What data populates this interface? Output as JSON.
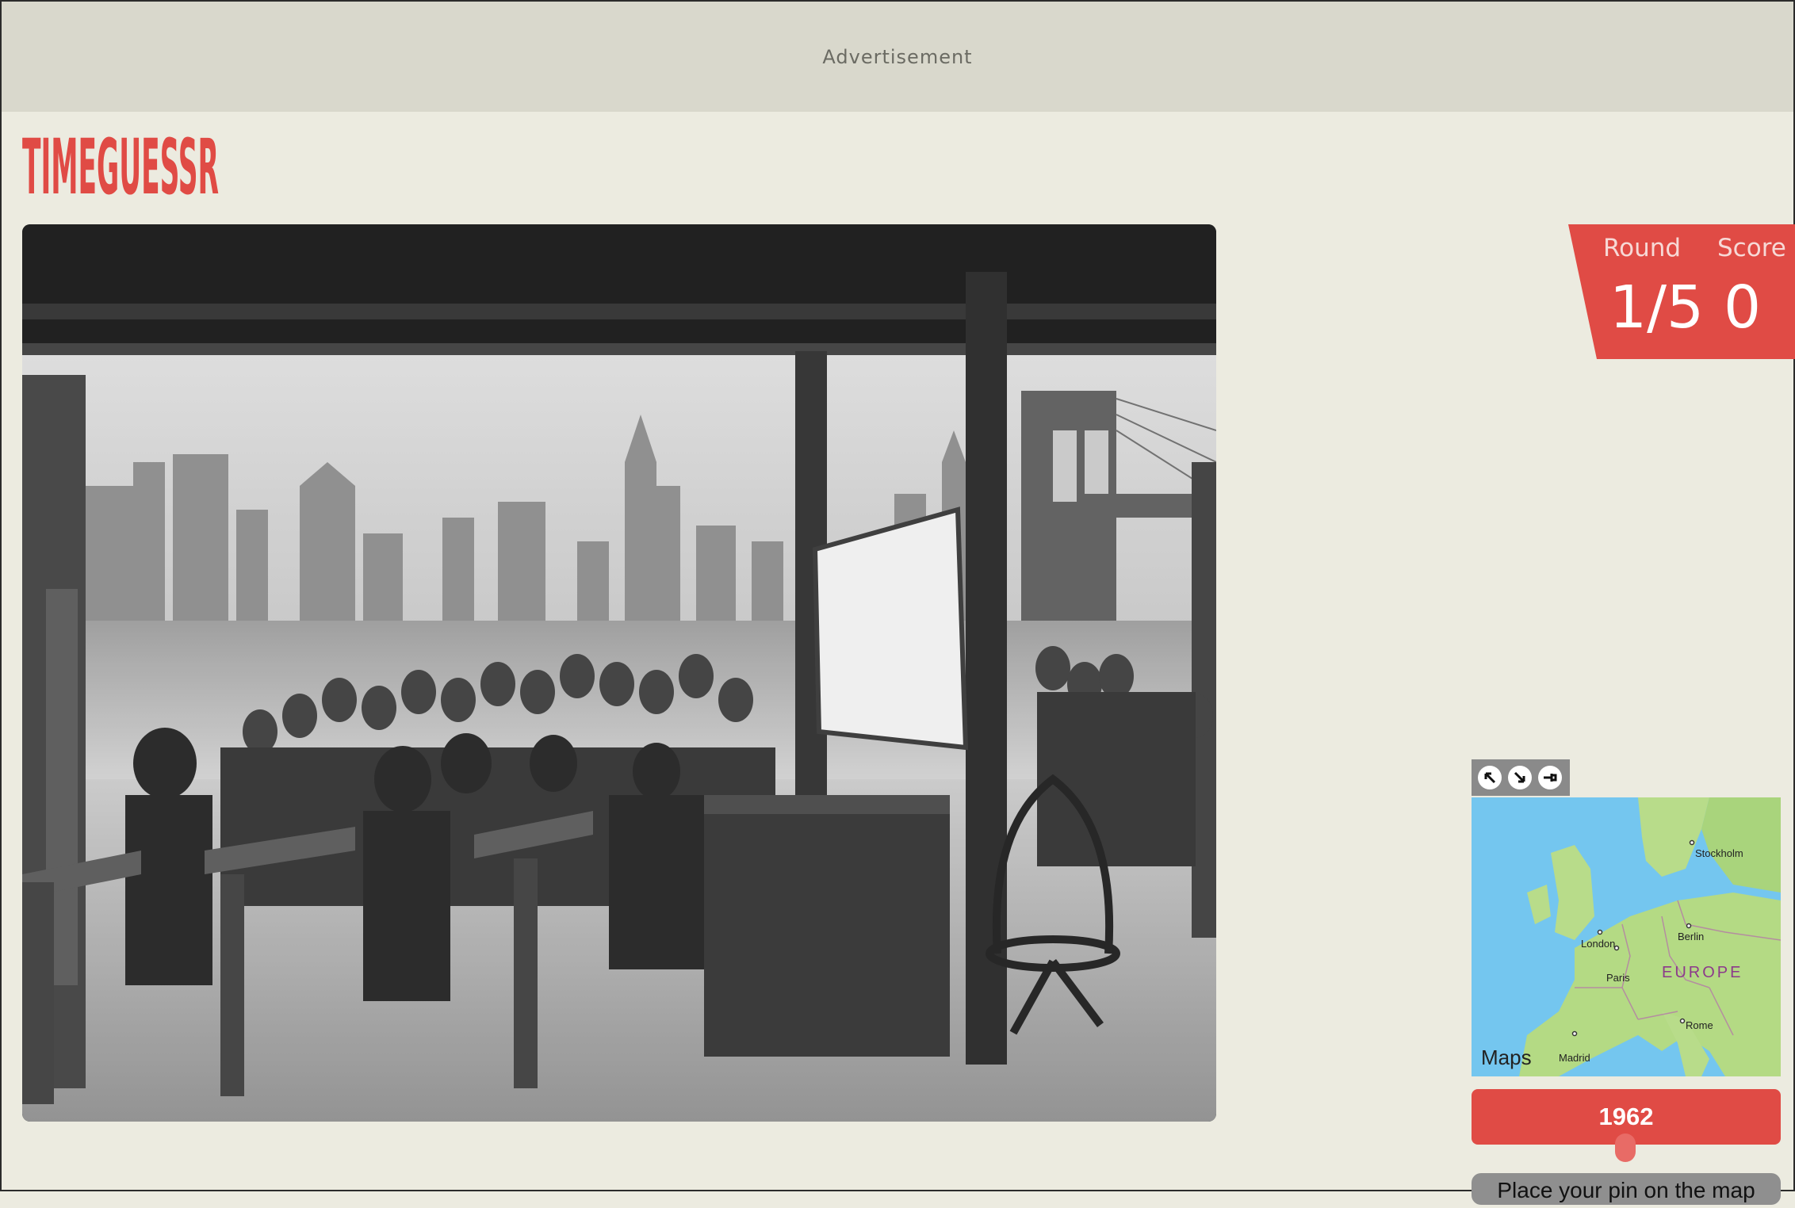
{
  "ad": {
    "label": "Advertisement"
  },
  "brand": {
    "name": "TIMEGUESSR",
    "color": "#e04b45"
  },
  "score_panel": {
    "round_label": "Round",
    "score_label": "Score",
    "round_value": "1/5",
    "score_value": "0",
    "color": "#e04b45"
  },
  "map": {
    "controls": [
      "arrow-up-left-icon",
      "arrow-down-right-icon",
      "pin-icon"
    ],
    "cities": {
      "stockholm": "Stockholm",
      "london": "London",
      "berlin": "Berlin",
      "paris": "Paris",
      "rome": "Rome",
      "madrid": "Madrid"
    },
    "region": "EUROPE",
    "brand": "Maps"
  },
  "year_slider": {
    "value": "1962",
    "position_fraction": 0.47
  },
  "place_pin_button": {
    "label": "Place your pin on the map"
  }
}
